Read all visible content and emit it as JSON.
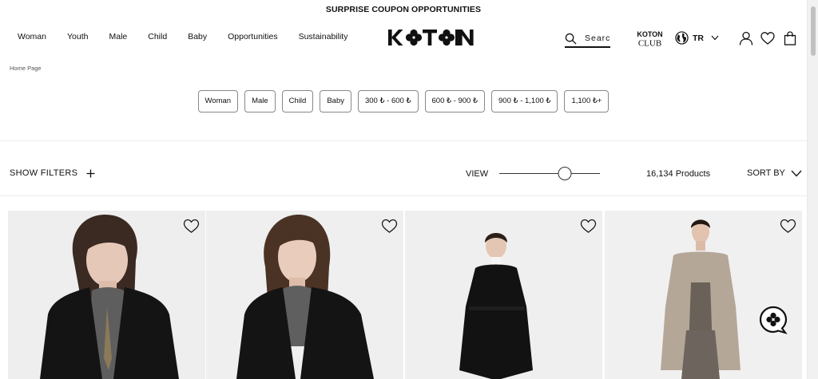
{
  "announcement": "SURPRISE COUPON OPPORTUNITIES",
  "nav": [
    "Woman",
    "Youth",
    "Male",
    "Child",
    "Baby",
    "Opportunities",
    "Sustainability"
  ],
  "logo_text": "KOTON",
  "club_logo": {
    "top": "KOTON",
    "bottom": "CLUB"
  },
  "search": {
    "placeholder": "Search"
  },
  "language": "TR",
  "breadcrumb": "Home Page",
  "chips": [
    "Woman",
    "Male",
    "Child",
    "Baby",
    "300 ₺ - 600 ₺",
    "600 ₺ - 900 ₺",
    "900 ₺ - 1,100 ₺",
    "1,100 ₺+"
  ],
  "toolbar": {
    "filters_label": "SHOW FILTERS",
    "view_label": "VIEW",
    "view_level": 0.65,
    "product_count": "16,134 Products",
    "sort_label": "SORT BY"
  },
  "products": [
    {
      "icon": "heart-outline-icon",
      "coat_color": "#141414",
      "background": "#eeeeee"
    },
    {
      "icon": "heart-outline-icon",
      "coat_color": "#141414",
      "background": "#efefef"
    },
    {
      "icon": "heart-outline-icon",
      "coat_color": "#121212",
      "background": "#efefef"
    },
    {
      "icon": "heart-outline-icon",
      "coat_color": "#b5a798",
      "background": "#f0f0f0"
    }
  ],
  "icons": {
    "search": "search-icon",
    "globe": "globe-icon",
    "user": "user-icon",
    "wishlist": "heart-icon",
    "bag": "shopping-bag-icon",
    "plus": "plus-icon",
    "sort": "chevron-down-icon",
    "chat": "chat-bubble-icon"
  },
  "colors": {
    "text": "#111111",
    "border": "#888888",
    "divider": "#ececec"
  }
}
